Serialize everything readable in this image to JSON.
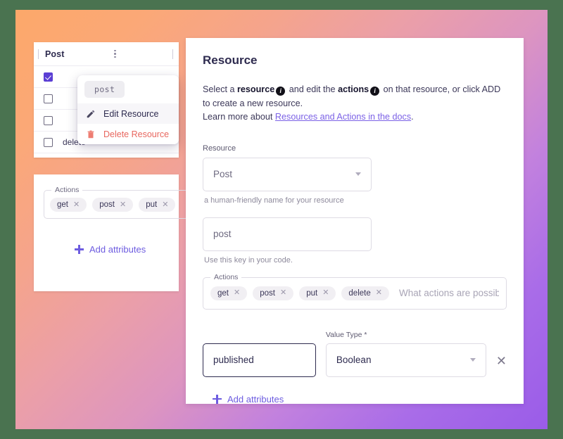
{
  "background": {
    "frame_color": "#4a7350",
    "gradient_from": "#fca86a",
    "gradient_mid": "#dd95c0",
    "gradient_to": "#9a5ce8"
  },
  "table_card": {
    "title": "Post",
    "menu_icon": "kebab-menu-icon",
    "rows": [
      {
        "label": "",
        "checked": true
      },
      {
        "label": "",
        "checked": false
      },
      {
        "label": "",
        "checked": false
      },
      {
        "label": "delete",
        "checked": false
      }
    ]
  },
  "context_menu": {
    "chip": "post",
    "items": [
      {
        "label": "Edit Resource",
        "icon": "pencil-icon"
      },
      {
        "label": "Delete Resource",
        "icon": "trash-icon"
      }
    ]
  },
  "actions_card": {
    "legend": "Actions",
    "chips": [
      "get",
      "post",
      "put"
    ],
    "add_attributes": "Add attributes"
  },
  "resource_panel": {
    "title": "Resource",
    "desc_1": "Select a ",
    "desc_bold_1": "resource",
    "desc_2": " and edit the ",
    "desc_bold_2": "actions",
    "desc_3": " on that resource, or click ADD to create a new resource.",
    "learn_more_prefix": "Learn more about ",
    "learn_more_link": "Resources and Actions in the docs",
    "learn_more_suffix": ".",
    "resource_label": "Resource",
    "resource_value": "Post",
    "resource_helper": "a human-friendly name for your resource",
    "key_value": "post",
    "key_helper": "Use this key in your code.",
    "actions_legend": "Actions",
    "action_chips": [
      "get",
      "post",
      "put",
      "delete"
    ],
    "actions_placeholder": "What actions are possible on res…",
    "attribute_name": "published",
    "value_type_label": "Value Type *",
    "value_type_value": "Boolean",
    "remove_attribute_icon": "close-icon",
    "add_attributes": "Add attributes",
    "accent_color": "#6d5ce0",
    "danger_color": "#e8675f"
  }
}
